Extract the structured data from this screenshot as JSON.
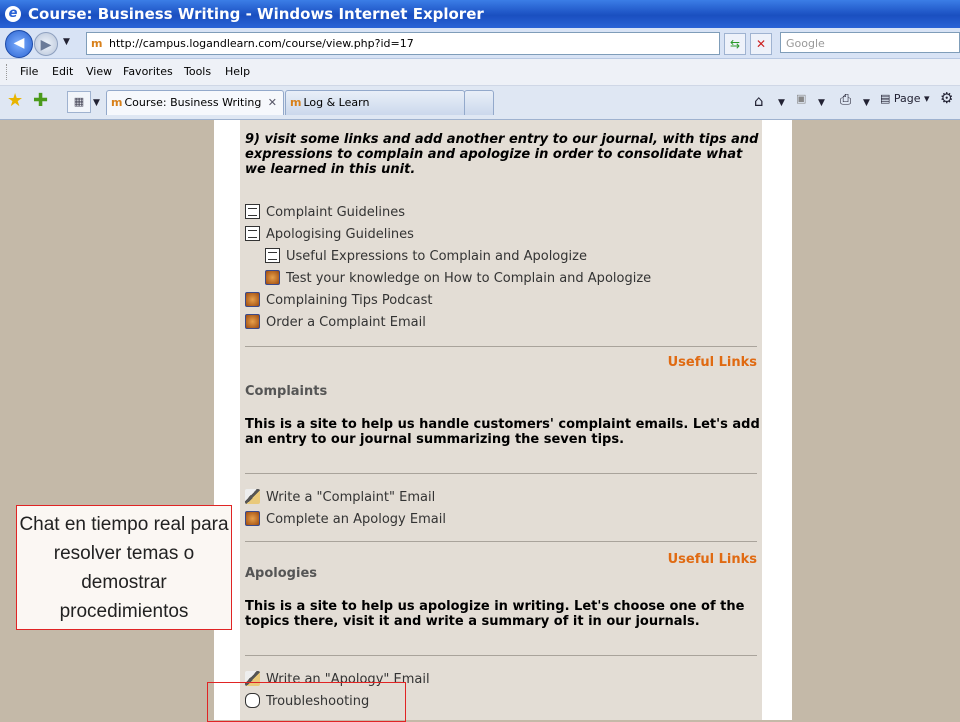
{
  "window": {
    "title": "Course: Business Writing - Windows Internet Explorer"
  },
  "address_bar": {
    "url": "http://campus.logandlearn.com/course/view.php?id=17",
    "search_placeholder": "Google"
  },
  "menu": [
    "File",
    "Edit",
    "View",
    "Favorites",
    "Tools",
    "Help"
  ],
  "tabs": [
    {
      "label": "Course: Business Writing",
      "active": true
    },
    {
      "label": "Log & Learn",
      "active": false
    }
  ],
  "toolbar": {
    "page_label": "Page"
  },
  "content": {
    "intro": "9) visit some links and add another entry to our journal, with tips and expressions to complain and apologize in order to consolidate what we learned in this unit.",
    "resources": [
      {
        "label": "Complaint Guidelines",
        "icon": "document-icon"
      },
      {
        "label": "Apologising Guidelines",
        "icon": "document-icon"
      },
      {
        "label": "Useful Expressions to Complain and Apologize",
        "icon": "document-icon"
      },
      {
        "label": "Test your knowledge on How to Complain and Apologize",
        "icon": "hot-potatoes-icon"
      },
      {
        "label": "Complaining Tips Podcast",
        "icon": "hot-potatoes-icon"
      },
      {
        "label": "Order a Complaint Email",
        "icon": "hot-potatoes-icon"
      }
    ],
    "useful_links_1": "Useful Links",
    "complaints_heading": "Complaints",
    "complaints_text": "This is a site to help us handle customers' complaint emails. Let's add an entry to our journal summarizing the seven tips.",
    "complaint_activities": [
      {
        "label": "Write a \"Complaint\" Email",
        "icon": "assignment-icon"
      },
      {
        "label": "Complete an Apology Email",
        "icon": "hot-potatoes-icon"
      }
    ],
    "useful_links_2": "Useful Links",
    "apologies_heading": "Apologies",
    "apologies_text": "This is a site to help us apologize in writing. Let's choose one of the topics there, visit it and write a summary of it in our journals.",
    "apology_activities": [
      {
        "label": "Write an \"Apology\" Email",
        "icon": "assignment-icon"
      },
      {
        "label": "Troubleshooting",
        "icon": "chat-icon"
      }
    ]
  },
  "callout": {
    "text": "Chat en tiempo real para resolver temas o demostrar procedimientos"
  },
  "colors": {
    "accent": "#e06a12",
    "callout_border": "#e02424",
    "page_bg": "#e3ddd5",
    "desktop_bg": "#c4b9a8"
  }
}
